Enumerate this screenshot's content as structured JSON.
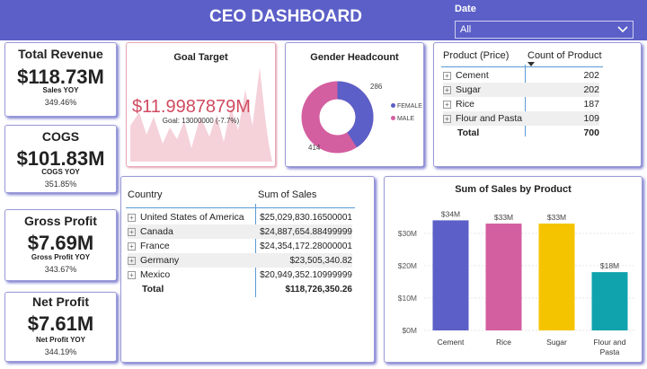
{
  "header": {
    "title": "CEO DASHBOARD"
  },
  "date_filter": {
    "label": "Date",
    "value": "All"
  },
  "kpis": [
    {
      "title": "Total Revenue",
      "value": "$118.73M",
      "sub": "Sales YOY",
      "pct": "349.46%"
    },
    {
      "title": "COGS",
      "value": "$101.83M",
      "sub": "COGS YOY",
      "pct": "351.85%"
    },
    {
      "title": "Gross Profit",
      "value": "$7.69M",
      "sub": "Gross Profit YOY",
      "pct": "343.67%"
    },
    {
      "title": "Net Profit",
      "value": "$7.61M",
      "sub": "Net Profit YOY",
      "pct": "344.19%"
    }
  ],
  "goal": {
    "title": "Goal Target",
    "value": "$11.9987879M",
    "goal_text": "Goal: 13000000 (-7.7%)"
  },
  "gender": {
    "title": "Gender Headcount",
    "legend": [
      "FEMALE",
      "MALE"
    ],
    "female": 286,
    "male": 414,
    "colors": {
      "female": "#5b5fc7",
      "male": "#d35ea0"
    }
  },
  "product_table": {
    "headers": [
      "Product (Price)",
      "Count of Product"
    ],
    "rows": [
      {
        "name": "Cement",
        "count": "202"
      },
      {
        "name": "Sugar",
        "count": "202"
      },
      {
        "name": "Rice",
        "count": "187"
      },
      {
        "name": "Flour and Pasta",
        "count": "109"
      }
    ],
    "total_label": "Total",
    "total_value": "700"
  },
  "country_table": {
    "headers": [
      "Country",
      "Sum of Sales"
    ],
    "rows": [
      {
        "name": "United States of America",
        "value": "$25,029,830.16500001"
      },
      {
        "name": "Canada",
        "value": "$24,887,654.88499999"
      },
      {
        "name": "France",
        "value": "$24,354,172.28000001"
      },
      {
        "name": "Germany",
        "value": "$23,505,340.82"
      },
      {
        "name": "Mexico",
        "value": "$20,949,352.10999999"
      }
    ],
    "total_label": "Total",
    "total_value": "$118,726,350.26"
  },
  "chart_data": {
    "type": "bar",
    "title": "Sum of Sales by Product",
    "categories": [
      "Cement",
      "Rice",
      "Sugar",
      "Flour and Pasta"
    ],
    "values": [
      34,
      33,
      33,
      18
    ],
    "data_labels": [
      "$34M",
      "$33M",
      "$33M",
      "$18M"
    ],
    "y_ticks": [
      0,
      10,
      20,
      30
    ],
    "y_tick_labels": [
      "$0M",
      "$10M",
      "$20M",
      "$30M"
    ],
    "ylim": [
      0,
      38
    ],
    "colors": [
      "#5b5fc7",
      "#d35ea0",
      "#f5c400",
      "#10a3ad"
    ],
    "grid": true
  }
}
